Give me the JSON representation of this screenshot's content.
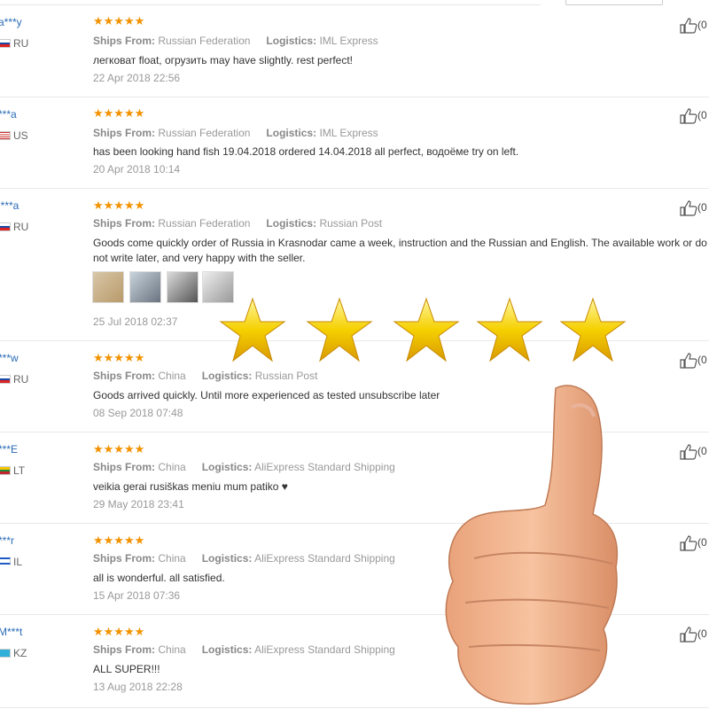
{
  "reviews": [
    {
      "user": "a***y",
      "country": "RU",
      "stars": "★★★★★",
      "ships_label": "Ships From:",
      "ships_from": "Russian Federation",
      "logistics_label": "Logistics:",
      "logistics": "IML Express",
      "text": "легковат float, огрузить may have slightly. rest perfect!",
      "text2": "",
      "date": "22 Apr 2018 22:56",
      "likes": "(0"
    },
    {
      "user": "***a",
      "country": "US",
      "stars": "★★★★★",
      "ships_label": "Ships From:",
      "ships_from": "Russian Federation",
      "logistics_label": "Logistics:",
      "logistics": "IML Express",
      "text": "has been looking hand fish 19.04.2018 ordered 14.04.2018 all perfect, водоёме try on left.",
      "text2": "",
      "date": "20 Apr 2018 10:14",
      "likes": "(0"
    },
    {
      "user": "l***a",
      "country": "RU",
      "stars": "★★★★★",
      "ships_label": "Ships From:",
      "ships_from": "Russian Federation",
      "logistics_label": "Logistics:",
      "logistics": "Russian Post",
      "text": "Goods come quickly order of Russia in Krasnodar came a week, instruction and the Russian and English. The available work or do",
      "text2": "not write later, and very happy with the seller.",
      "date": "25 Jul 2018 02:37",
      "likes": "(0"
    },
    {
      "user": "***w",
      "country": "RU",
      "stars": "★★★★★",
      "ships_label": "Ships From:",
      "ships_from": "China",
      "logistics_label": "Logistics:",
      "logistics": "Russian Post",
      "text": "Goods arrived quickly. Until more experienced as tested unsubscribe later",
      "text2": "",
      "date": "08 Sep 2018 07:48",
      "likes": "(0"
    },
    {
      "user": "***E",
      "country": "LT",
      "stars": "★★★★★",
      "ships_label": "Ships From:",
      "ships_from": "China",
      "logistics_label": "Logistics:",
      "logistics": "AliExpress Standard Shipping",
      "text": "veikia gerai rusiškas meniu mum patiko ♥",
      "text2": "",
      "date": "29 May 2018 23:41",
      "likes": "(0"
    },
    {
      "user": "***r",
      "country": "IL",
      "stars": "★★★★★",
      "ships_label": "Ships From:",
      "ships_from": "China",
      "logistics_label": "Logistics:",
      "logistics": "AliExpress Standard Shipping",
      "text": "all is wonderful. all satisfied.",
      "text2": "",
      "date": "15 Apr 2018 07:36",
      "likes": "(0"
    },
    {
      "user": "M***t",
      "country": "KZ",
      "stars": "★★★★★",
      "ships_label": "Ships From:",
      "ships_from": "China",
      "logistics_label": "Logistics:",
      "logistics": "AliExpress Standard Shipping",
      "text": "ALL SUPER!!!",
      "text2": "",
      "date": "13 Aug 2018 22:28",
      "likes": "(0"
    }
  ],
  "colors": {
    "link": "#2a6bb5",
    "star": "#f39200",
    "big_star": "#f5d000"
  },
  "icons": {
    "like": "thumbs-up-icon",
    "big_stars": "star-icon",
    "hand": "thumbs-up-hand-icon"
  }
}
